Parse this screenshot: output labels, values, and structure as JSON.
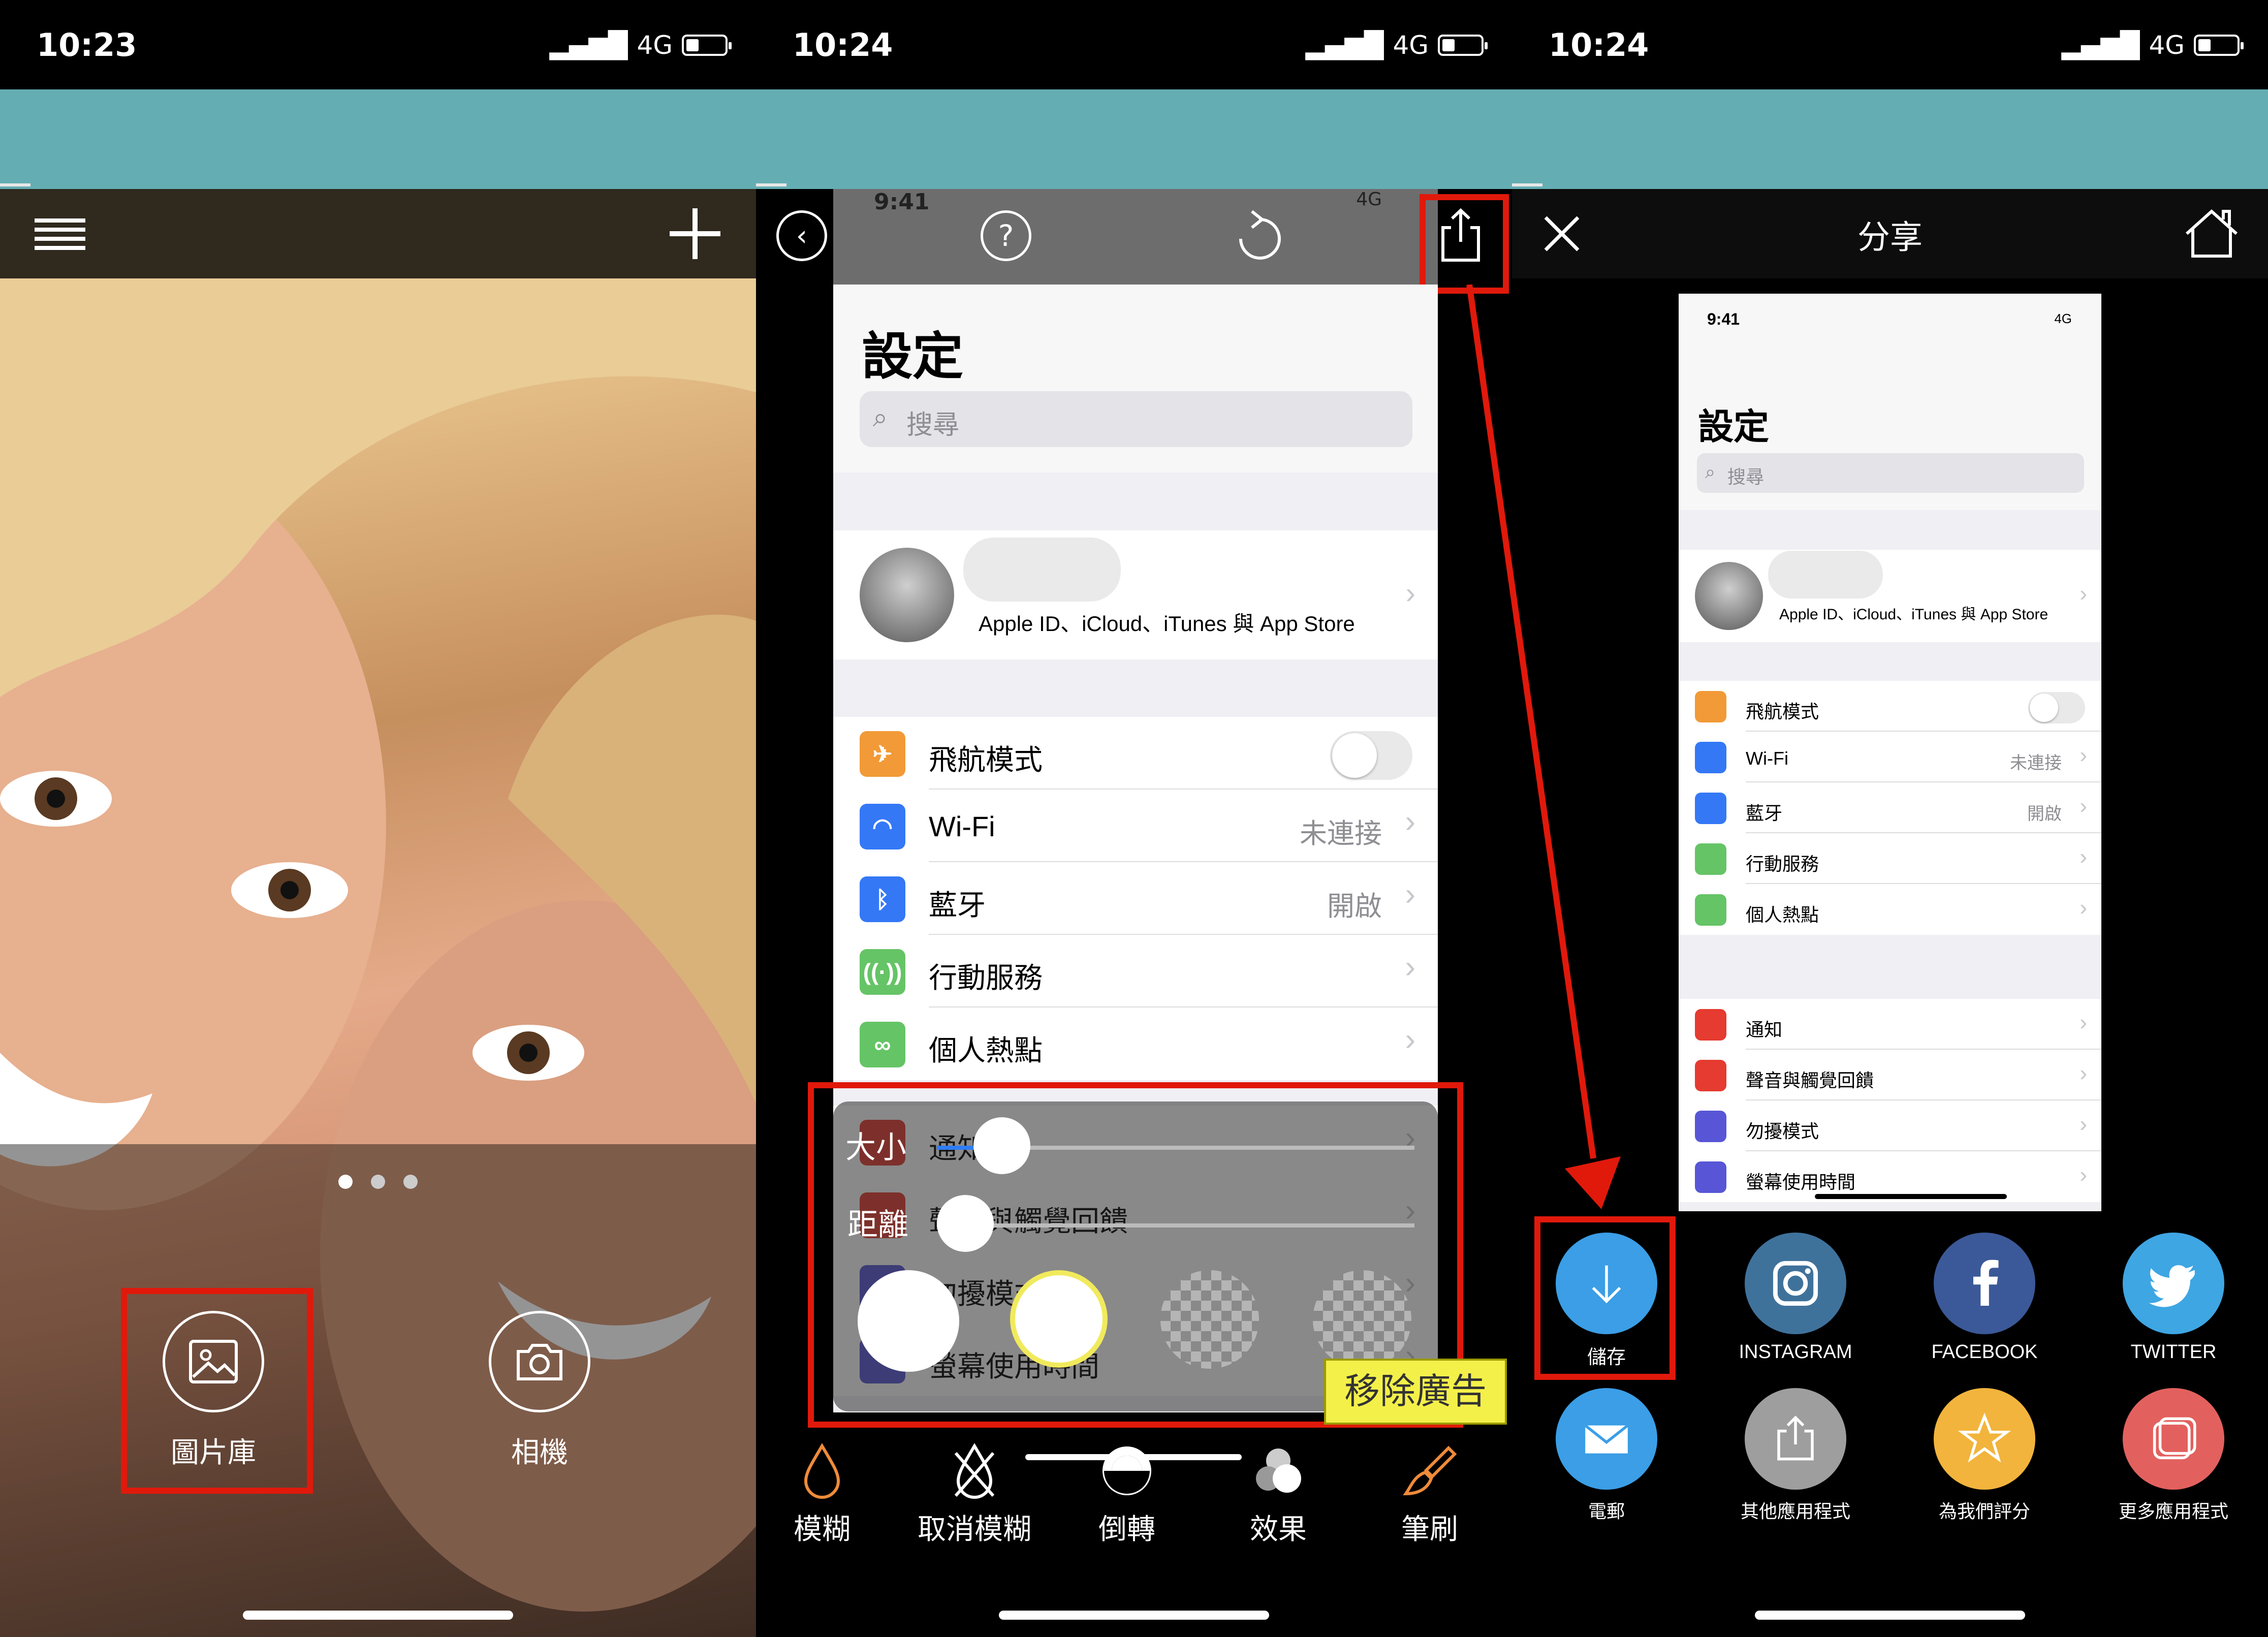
{
  "panel1": {
    "status": {
      "time": "10:23",
      "network": "4G"
    },
    "dots": 3,
    "buttons": {
      "library_label": "圖片庫",
      "camera_label": "相機"
    }
  },
  "panel2": {
    "status": {
      "time": "10:24",
      "network": "4G"
    },
    "inner_status": {
      "time": "9:41",
      "network": "4G"
    },
    "settings": {
      "title": "設定",
      "search_placeholder": "搜尋",
      "account_subtitle": "Apple ID、iCloud、iTunes 與 App Store",
      "rows": [
        {
          "icon": "airplane-icon",
          "label": "飛航模式",
          "value": "",
          "color": "#f19a37"
        },
        {
          "icon": "wifi-icon",
          "label": "Wi-Fi",
          "value": "未連接",
          "color": "#3478f6"
        },
        {
          "icon": "bluetooth-icon",
          "label": "藍牙",
          "value": "開啟",
          "color": "#3478f6"
        },
        {
          "icon": "cellular-icon",
          "label": "行動服務",
          "value": "",
          "color": "#65c466"
        },
        {
          "icon": "hotspot-icon",
          "label": "個人熱點",
          "value": "",
          "color": "#65c466"
        }
      ],
      "overlay_rows": [
        {
          "label": "通知",
          "color": "#e53b30"
        },
        {
          "label": "聲音與觸覺回饋",
          "color": "#e53b30"
        },
        {
          "label": "勿擾模式",
          "color": "#5856d6"
        },
        {
          "label": "螢幕使用時間",
          "color": "#5856d6"
        }
      ]
    },
    "sliders": {
      "size_label": "大小",
      "distance_label": "距離",
      "size_value": 0.12,
      "distance_value": 0.05
    },
    "remove_ads": "移除廣告",
    "tools": [
      "模糊",
      "取消模糊",
      "倒轉",
      "效果",
      "筆刷"
    ]
  },
  "panel3": {
    "status": {
      "time": "10:24",
      "network": "4G"
    },
    "title": "分享",
    "preview": {
      "time": "9:41",
      "network": "4G",
      "title": "設定",
      "search": "搜尋",
      "account_subtitle": "Apple ID、iCloud、iTunes 與 App Store",
      "group1": [
        {
          "label": "飛航模式",
          "value": "",
          "color": "#f19a37"
        },
        {
          "label": "Wi-Fi",
          "value": "未連接",
          "color": "#3478f6"
        },
        {
          "label": "藍牙",
          "value": "開啟",
          "color": "#3478f6"
        },
        {
          "label": "行動服務",
          "value": "",
          "color": "#65c466"
        },
        {
          "label": "個人熱點",
          "value": "",
          "color": "#65c466"
        }
      ],
      "group2": [
        {
          "label": "通知",
          "color": "#e53b30"
        },
        {
          "label": "聲音與觸覺回饋",
          "color": "#e53b30"
        },
        {
          "label": "勿擾模式",
          "color": "#5856d6"
        },
        {
          "label": "螢幕使用時間",
          "color": "#5856d6"
        }
      ]
    },
    "share_items": [
      {
        "label": "儲存",
        "color": "#3b9ee6"
      },
      {
        "label": "INSTAGRAM",
        "color": "#3f729b"
      },
      {
        "label": "FACEBOOK",
        "color": "#3b5998"
      },
      {
        "label": "TWITTER",
        "color": "#3ea6e3"
      },
      {
        "label": "電郵",
        "color": "#3b9ee6"
      },
      {
        "label": "其他應用程式",
        "color": "#9e9e9e"
      },
      {
        "label": "為我們評分",
        "color": "#f2b43c"
      },
      {
        "label": "更多應用程式",
        "color": "#e2615e"
      }
    ]
  },
  "accent_red": "#e0190b"
}
